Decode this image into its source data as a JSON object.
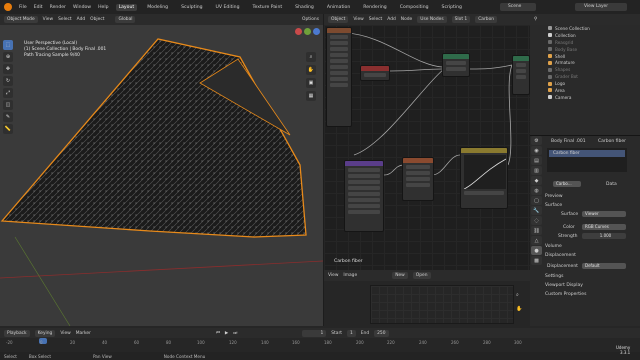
{
  "menu": {
    "file": "File",
    "edit": "Edit",
    "render": "Render",
    "window": "Window",
    "help": "Help"
  },
  "workspaces": [
    "Layout",
    "Modeling",
    "Sculpting",
    "UV Editing",
    "Texture Paint",
    "Shading",
    "Animation",
    "Rendering",
    "Compositing",
    "Scripting"
  ],
  "scene": {
    "scene_label": "Scene",
    "view_layer": "View Layer"
  },
  "viewport": {
    "mode": "Object Mode",
    "view": "View",
    "select": "Select",
    "add": "Add",
    "object": "Object",
    "transform": "Global",
    "options": "Options",
    "info_line1": "User Perspective (Local)",
    "info_line2": "(1) Scene Collection | Body Final .001",
    "info_line3": "Path Tracing Sample 9/40"
  },
  "node_editor": {
    "type": "Object",
    "view": "View",
    "select": "Select",
    "add": "Add",
    "node": "Node",
    "use_nodes": "Use Nodes",
    "slot": "Slot 1",
    "material": "Carbon",
    "material_label": "Carbon fiber"
  },
  "image_editor": {
    "view": "View",
    "image": "Image",
    "new": "New",
    "open": "Open"
  },
  "outliner": {
    "root": "Scene Collection",
    "items": [
      {
        "name": "Collection",
        "color": "#cfcfcf"
      },
      {
        "name": "Reasgrid",
        "color": "#7a7a7a"
      },
      {
        "name": "Body Base",
        "color": "#7a7a7a"
      },
      {
        "name": "Shell",
        "color": "#e0a24a"
      },
      {
        "name": "Armature",
        "color": "#e0a24a"
      },
      {
        "name": "Shapes",
        "color": "#7a7a7a"
      },
      {
        "name": "Grader Bot",
        "color": "#7a7a7a"
      },
      {
        "name": "Logo",
        "color": "#e0a24a"
      },
      {
        "name": "Area",
        "color": "#e0a24a"
      },
      {
        "name": "Camera",
        "color": "#cfcfcf"
      }
    ]
  },
  "properties": {
    "breadcrumb": "Body Final .001",
    "breadcrumb_material": "Carbon fiber",
    "material_slot": "Carbon fiber",
    "material_field": "Carbo...",
    "data_label": "Data",
    "preview": "Preview",
    "surface_section": "Surface",
    "surface_label": "Surface",
    "surface_value": "Viewer",
    "color_label": "Color",
    "color_value": "RGB Curves",
    "strength_label": "Strength",
    "strength_value": "1.000",
    "volume": "Volume",
    "displacement_section": "Displacement",
    "displacement_label": "Displacement",
    "displacement_value": "Default",
    "settings": "Settings",
    "viewport_display": "Viewport Display",
    "custom_props": "Custom Properties"
  },
  "timeline": {
    "playback": "Playback",
    "keying": "Keying",
    "view": "View",
    "marker": "Marker",
    "current_frame": "1",
    "start_label": "Start",
    "start": "1",
    "end_label": "End",
    "end": "250",
    "frames": [
      "-20",
      "0",
      "20",
      "40",
      "60",
      "80",
      "100",
      "120",
      "140",
      "160",
      "180",
      "200",
      "220",
      "240",
      "260",
      "280",
      "300"
    ]
  },
  "status": {
    "select": "Select",
    "box_select": "Box Select",
    "pan_view": "Pan View",
    "context": "Node Context Menu"
  },
  "watermark": {
    "line1": "Udemy",
    "line2": "3.3.1"
  }
}
